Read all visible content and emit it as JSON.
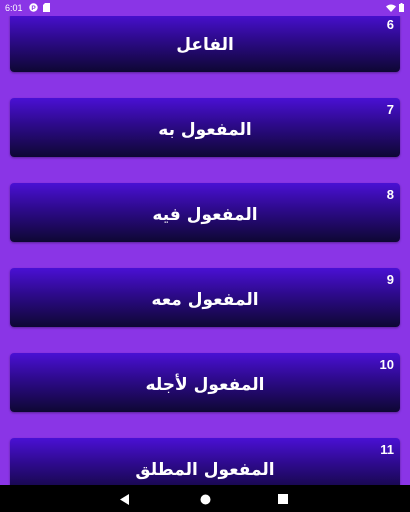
{
  "status_bar": {
    "time": "6:01",
    "icons": [
      "p-badge-icon",
      "sd-card-icon",
      "wifi-icon",
      "battery-icon"
    ]
  },
  "items": [
    {
      "number": "6",
      "title": "الفاعل"
    },
    {
      "number": "7",
      "title": "المفعول به"
    },
    {
      "number": "8",
      "title": "المفعول فيه"
    },
    {
      "number": "9",
      "title": "المفعول معه"
    },
    {
      "number": "10",
      "title": "المفعول لأجله"
    },
    {
      "number": "11",
      "title": "المفعول المطلق"
    }
  ],
  "nav_bar": {
    "icons": [
      "back-icon",
      "home-icon",
      "recents-icon"
    ]
  },
  "colors": {
    "background": "#8a35e6",
    "card_top": "#4a10d4",
    "card_bottom": "#0e0733",
    "nav_bar": "#000000"
  }
}
